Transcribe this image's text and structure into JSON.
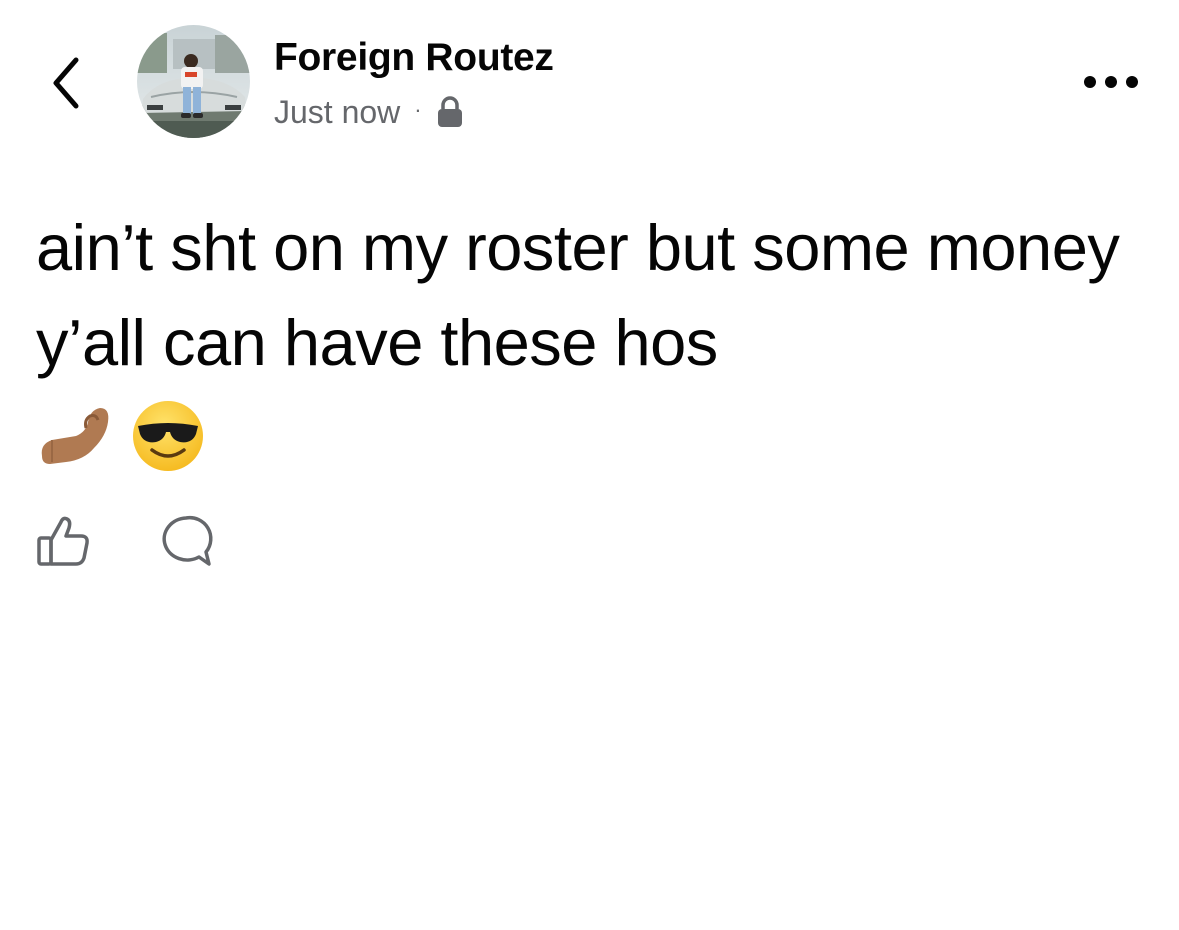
{
  "header": {
    "back_icon": "chevron-left-icon",
    "author_name": "Foreign Routez",
    "timestamp": "Just now",
    "separator": "·",
    "privacy_icon": "lock-icon",
    "more_icon": "more-horizontal-icon"
  },
  "post": {
    "text": "ain’t sht on my roster but some money y’all can have these hos",
    "emojis": [
      {
        "icon": "pinched-fingers-emoji",
        "char": "🤌🏽"
      },
      {
        "icon": "smiling-face-with-sunglasses-emoji",
        "char": "😎"
      }
    ]
  },
  "actions": {
    "like_icon": "thumbs-up-icon",
    "comment_icon": "comment-icon"
  },
  "colors": {
    "text_primary": "#050505",
    "text_secondary": "#65676b",
    "icon_gray": "#65676b",
    "background": "#ffffff"
  }
}
